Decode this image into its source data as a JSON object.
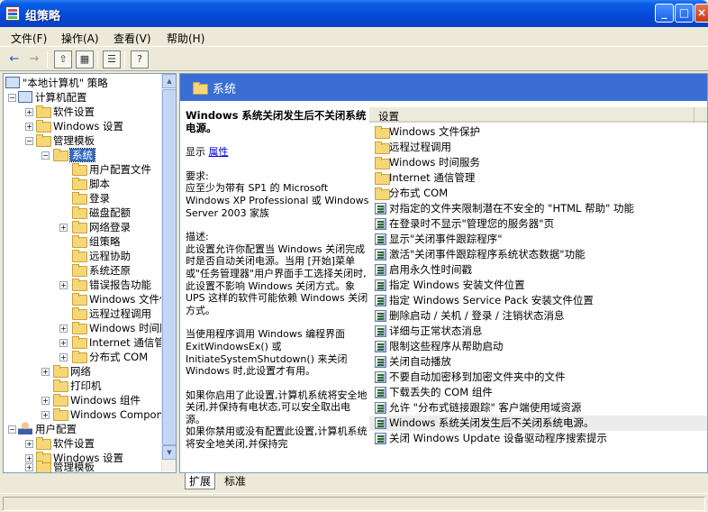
{
  "window": {
    "title": "组策略",
    "min": "_",
    "max": "□",
    "close": "×"
  },
  "menu": [
    "文件(F)",
    "操作(A)",
    "查看(V)",
    "帮助(H)"
  ],
  "toolbar": {
    "back": "←",
    "forward": "→",
    "up": "⇧",
    "show_hide": "▦",
    "export": "☰",
    "help": "?"
  },
  "tree": {
    "root": "\"本地计算机\" 策略",
    "computer": "计算机配置",
    "software_settings": "软件设置",
    "windows_settings": "Windows 设置",
    "admin_templates": "管理模板",
    "system": "系统",
    "system_children": [
      "用户配置文件",
      "脚本",
      "登录",
      "磁盘配额",
      "网络登录",
      "组策略",
      "远程协助",
      "系统还原",
      "错误报告功能",
      "Windows 文件保护",
      "远程过程调用",
      "Windows 时间服务",
      "Internet 通信管理",
      "分布式 COM"
    ],
    "network": "网络",
    "printers": "打印机",
    "windows_components": "Windows 组件",
    "windows_components_2": "Windows Components",
    "user": "用户配置",
    "user_software": "软件设置",
    "user_windows": "Windows 设置",
    "user_admin": "管理模板"
  },
  "header": {
    "title": "系统"
  },
  "description": {
    "title": "Windows 系统关闭发生后不关闭系统电源。",
    "show_label": "显示",
    "show_link": "属性",
    "requirements": "要求:\n应至少为带有 SP1 的 Microsoft Windows XP Professional 或 Windows Server 2003 家族",
    "desc": "描述:\n此设置允许你配置当 Windows 关闭完成时是否自动关闭电源。当用 [开始]菜单或\"任务管理器\"用户界面手工选择关闭时,此设置不影响 Windows 关闭方式。象 UPS 这样的软件可能依赖 Windows 关闭方式。",
    "p3": "当使用程序调用 Windows 编程界面 ExitWindowsEx() 或 InitiateSystemShutdown() 来关闭 Windows 时,此设置才有用。",
    "p4": "如果你启用了此设置,计算机系统将安全地关闭,并保持有电状态,可以安全取出电源。",
    "p5": "如果你禁用或没有配置此设置,计算机系统将安全地关闭,并保持完"
  },
  "list": {
    "column": "设置",
    "items": [
      {
        "icon": "folder",
        "label": "Windows 文件保护"
      },
      {
        "icon": "folder",
        "label": "远程过程调用"
      },
      {
        "icon": "folder",
        "label": "Windows 时间服务"
      },
      {
        "icon": "folder",
        "label": "Internet 通信管理"
      },
      {
        "icon": "folder",
        "label": "分布式 COM"
      },
      {
        "icon": "setting",
        "label": "对指定的文件夹限制潜在不安全的 \"HTML 帮助\" 功能"
      },
      {
        "icon": "setting",
        "label": "在登录时不显示\"管理您的服务器\"页"
      },
      {
        "icon": "setting",
        "label": "显示\"关闭事件跟踪程序\""
      },
      {
        "icon": "setting",
        "label": "激活\"关闭事件跟踪程序系统状态数据\"功能"
      },
      {
        "icon": "setting",
        "label": "启用永久性时间戳"
      },
      {
        "icon": "setting",
        "label": "指定 Windows 安装文件位置"
      },
      {
        "icon": "setting",
        "label": "指定 Windows Service Pack 安装文件位置"
      },
      {
        "icon": "setting",
        "label": "删除启动 / 关机 / 登录 / 注销状态消息"
      },
      {
        "icon": "setting",
        "label": "详细与正常状态消息"
      },
      {
        "icon": "setting",
        "label": "限制这些程序从帮助启动"
      },
      {
        "icon": "setting",
        "label": "关闭自动播放"
      },
      {
        "icon": "setting",
        "label": "不要自动加密移到加密文件夹中的文件"
      },
      {
        "icon": "setting",
        "label": "下载丢失的 COM 组件"
      },
      {
        "icon": "setting",
        "label": "允许 \"分布式链接跟踪\" 客户端使用域资源"
      },
      {
        "icon": "setting",
        "label": "Windows 系统关闭发生后不关闭系统电源。"
      },
      {
        "icon": "setting",
        "label": "关闭 Windows Update 设备驱动程序搜索提示"
      }
    ]
  },
  "tabs": {
    "extended": "扩展",
    "standard": "标准"
  }
}
